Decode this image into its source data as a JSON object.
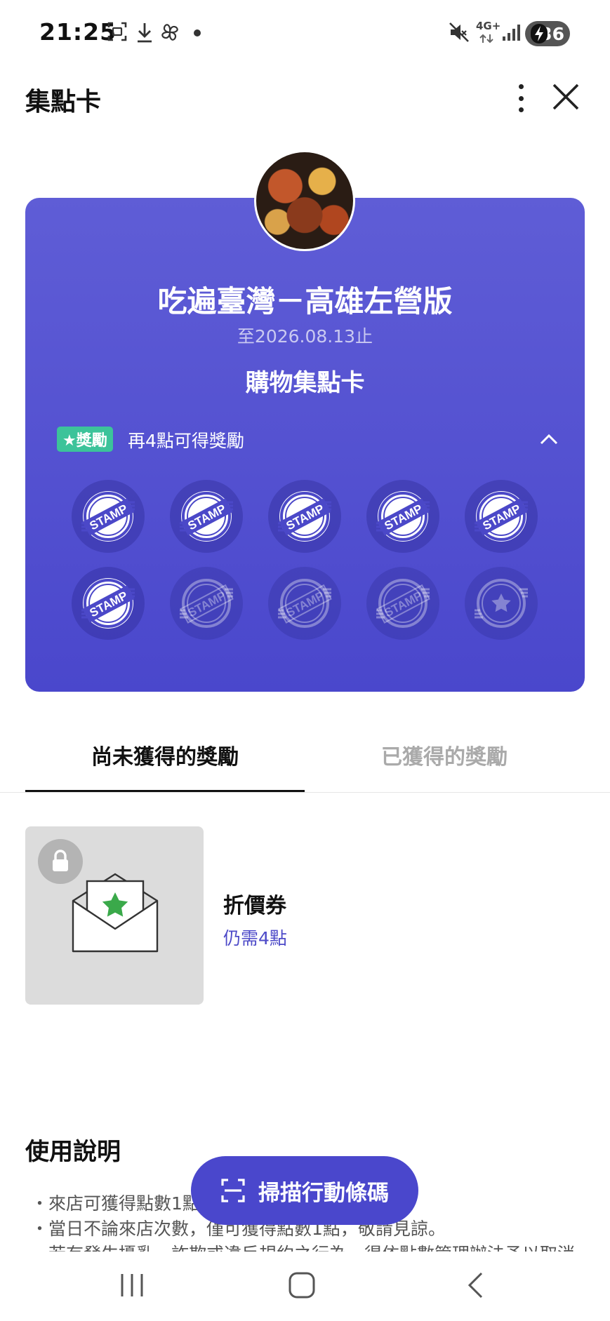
{
  "status_bar": {
    "time": "21:25",
    "battery_level": "36",
    "network_label": "4G+",
    "left_icons": [
      "screenshot-icon",
      "download-icon",
      "pinwheel-icon",
      "notification-dot-icon"
    ],
    "right_icons": [
      "mute-icon",
      "signal-icon",
      "battery-charging-icon"
    ]
  },
  "header": {
    "title": "集點卡"
  },
  "card": {
    "store_name": "吃遍臺灣－高雄左營版",
    "expiry": "至2026.08.13止",
    "subtitle": "購物集點卡",
    "reward_badge": "★獎勵",
    "reward_progress_text": "再4點可得獎勵",
    "stamp_label": "STAMP",
    "stamps_total": 10,
    "stamps_collected": 6,
    "colors": {
      "gradient_top": "#5f5dd6",
      "gradient_bottom": "#4a47cc",
      "badge": "#3cc39a"
    }
  },
  "tabs": [
    {
      "label": "尚未獲得的獎勵",
      "active": true
    },
    {
      "label": "已獲得的獎勵",
      "active": false
    }
  ],
  "reward_item": {
    "name": "折價券",
    "points_needed": "仍需4點",
    "locked": true,
    "icons": [
      "lock-icon",
      "envelope-star-icon"
    ]
  },
  "instructions": {
    "title": "使用說明",
    "items": [
      "來店可獲得點數1點",
      "當日不論來店次數，僅可獲得點數1點，敬請見諒。",
      "若有發生擾亂、詐欺或違反規約之行為，得依點數管理辦法予以取消。"
    ]
  },
  "scan_button": {
    "label": "掃描行動條碼",
    "color": "#4a47cc"
  },
  "nav_bar": {
    "buttons": [
      "recents",
      "home",
      "back"
    ]
  }
}
